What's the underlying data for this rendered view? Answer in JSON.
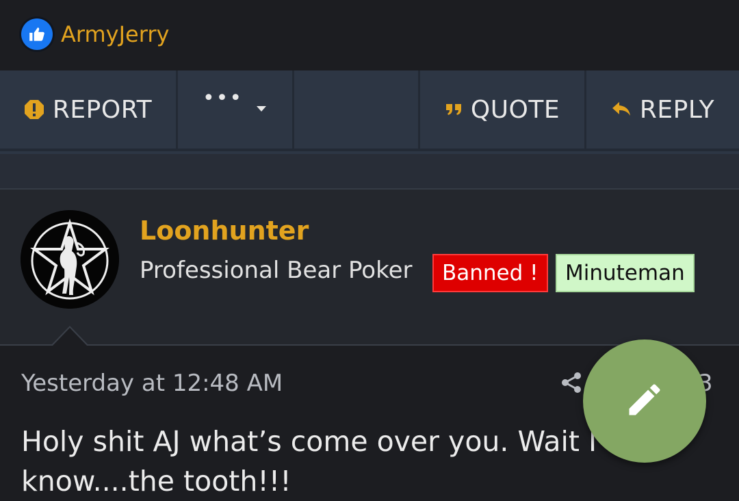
{
  "reactions": {
    "user": "ArmyJerry",
    "icon": "thumbs-up-icon",
    "color": "#1877f2"
  },
  "actions": {
    "report_label": "REPORT",
    "more_icon": "•••",
    "quote_label": "QUOTE",
    "reply_label": "REPLY",
    "accent": "#e2a31f"
  },
  "post": {
    "username": "Loonhunter",
    "user_title": "Professional Bear Poker",
    "banners": [
      {
        "label": "Banned !",
        "color": "#de0000"
      },
      {
        "label": "Minuteman",
        "color": "#d0f7c8"
      }
    ],
    "timestamp": "Yesterday at 12:48 AM",
    "post_number_partial": "3",
    "body": "Holy shit AJ what’s come over you. Wait I know....the tooth!!!"
  },
  "fab": {
    "icon": "pencil-icon",
    "color": "#84a763"
  }
}
